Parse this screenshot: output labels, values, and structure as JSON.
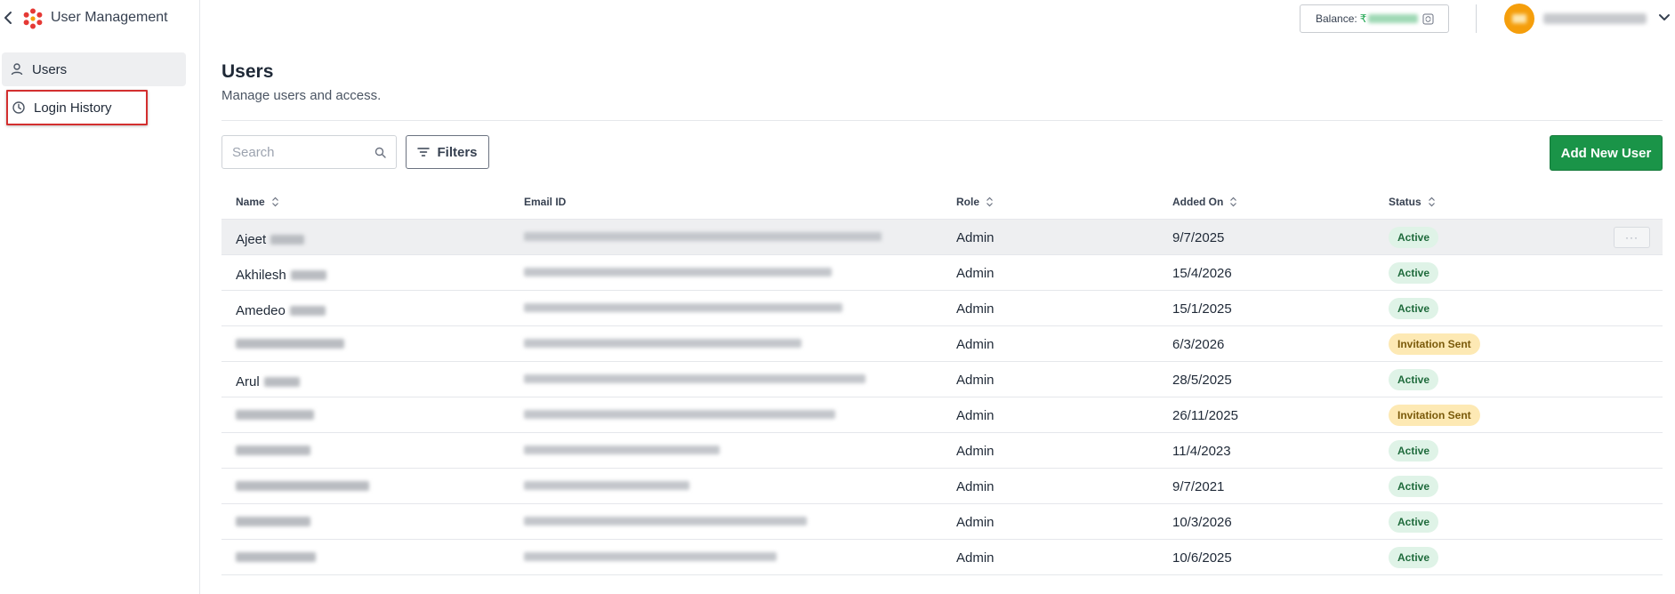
{
  "app": {
    "title": "User Management"
  },
  "sidebar": {
    "items": [
      {
        "label": "Users",
        "icon": "user-icon",
        "active": true
      },
      {
        "label": "Login History",
        "icon": "clock-icon",
        "active": false
      }
    ]
  },
  "header": {
    "balance_label": "Balance:",
    "currency_symbol": "₹"
  },
  "page": {
    "title": "Users",
    "subtitle": "Manage users and access."
  },
  "toolbar": {
    "search_placeholder": "Search",
    "filters_label": "Filters",
    "add_label": "Add New User"
  },
  "table": {
    "columns": [
      "Name",
      "Email ID",
      "Role",
      "Added On",
      "Status"
    ],
    "rows": [
      {
        "first_name": "Ajeet",
        "role": "Admin",
        "added_on": "9/7/2025",
        "status": "Active"
      },
      {
        "first_name": "Akhilesh",
        "role": "Admin",
        "added_on": "15/4/2026",
        "status": "Active"
      },
      {
        "first_name": "Amedeo",
        "role": "Admin",
        "added_on": "15/1/2025",
        "status": "Active"
      },
      {
        "first_name": "",
        "role": "Admin",
        "added_on": "6/3/2026",
        "status": "Invitation Sent"
      },
      {
        "first_name": "Arul",
        "role": "Admin",
        "added_on": "28/5/2025",
        "status": "Active"
      },
      {
        "first_name": "",
        "role": "Admin",
        "added_on": "26/11/2025",
        "status": "Invitation Sent"
      },
      {
        "first_name": "",
        "role": "Admin",
        "added_on": "11/4/2023",
        "status": "Active"
      },
      {
        "first_name": "",
        "role": "Admin",
        "added_on": "9/7/2021",
        "status": "Active"
      },
      {
        "first_name": "",
        "role": "Admin",
        "added_on": "10/3/2026",
        "status": "Active"
      },
      {
        "first_name": "",
        "role": "Admin",
        "added_on": "10/6/2025",
        "status": "Active"
      }
    ]
  },
  "colors": {
    "primary_green": "#1a9448",
    "active_badge_bg": "#dff3e7",
    "invite_badge_bg": "#fde9b4",
    "highlight_red": "#d32f2f",
    "avatar_orange": "#f59e0b"
  }
}
